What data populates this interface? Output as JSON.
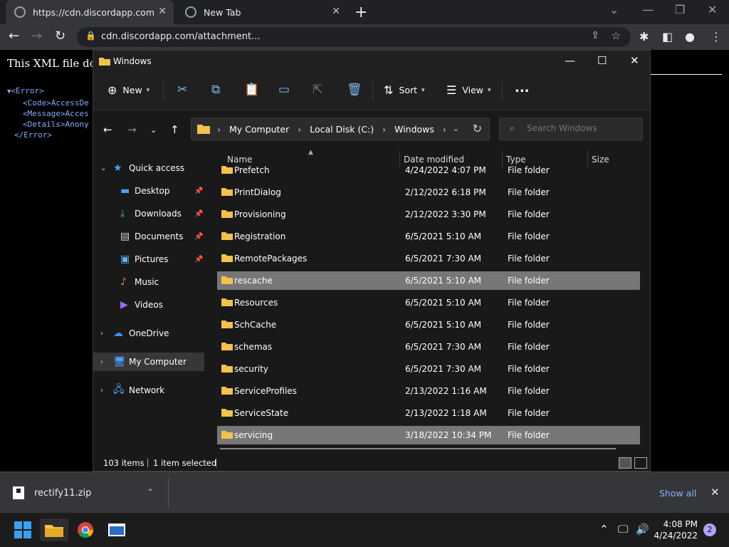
{
  "browser": {
    "tabs": [
      {
        "title": "https://cdn.discordapp.com/attac"
      },
      {
        "title": "New Tab"
      }
    ],
    "address_url": "cdn.discordapp.com/attachment..."
  },
  "page": {
    "heading": "This XML file doe",
    "code_lines": [
      "<Error>",
      "<Code>AccessDe",
      "<Message>Acces",
      "<Details>Anony",
      "</Error>"
    ]
  },
  "explorer": {
    "title": "Windows",
    "commands": {
      "new": "New",
      "sort": "Sort",
      "view": "View",
      "more": "..."
    },
    "breadcrumb": [
      "My Computer",
      "Local Disk (C:)",
      "Windows"
    ],
    "search_placeholder": "Search Windows",
    "nav": {
      "quick_access": "Quick access",
      "desktop": "Desktop",
      "downloads": "Downloads",
      "documents": "Documents",
      "pictures": "Pictures",
      "music": "Music",
      "videos": "Videos",
      "onedrive": "OneDrive",
      "my_computer": "My Computer",
      "network": "Network"
    },
    "columns": {
      "name": "Name",
      "date": "Date modified",
      "type": "Type",
      "size": "Size"
    },
    "files": [
      {
        "name": "Prefetch",
        "date": "4/24/2022 4:07 PM",
        "type": "File folder"
      },
      {
        "name": "PrintDialog",
        "date": "2/12/2022 6:18 PM",
        "type": "File folder"
      },
      {
        "name": "Provisioning",
        "date": "2/12/2022 3:30 PM",
        "type": "File folder"
      },
      {
        "name": "Registration",
        "date": "6/5/2021 5:10 AM",
        "type": "File folder"
      },
      {
        "name": "RemotePackages",
        "date": "6/5/2021 7:30 AM",
        "type": "File folder"
      },
      {
        "name": "rescache",
        "date": "6/5/2021 5:10 AM",
        "type": "File folder"
      },
      {
        "name": "Resources",
        "date": "6/5/2021 5:10 AM",
        "type": "File folder"
      },
      {
        "name": "SchCache",
        "date": "6/5/2021 5:10 AM",
        "type": "File folder"
      },
      {
        "name": "schemas",
        "date": "6/5/2021 7:30 AM",
        "type": "File folder"
      },
      {
        "name": "security",
        "date": "6/5/2021 7:30 AM",
        "type": "File folder"
      },
      {
        "name": "ServiceProfiles",
        "date": "2/13/2022 1:16 AM",
        "type": "File folder"
      },
      {
        "name": "ServiceState",
        "date": "2/13/2022 1:18 AM",
        "type": "File folder"
      },
      {
        "name": "servicing",
        "date": "3/18/2022 10:34 PM",
        "type": "File folder"
      }
    ],
    "status": {
      "count": "103 items",
      "selected": "1 item selected"
    }
  },
  "download_bar": {
    "file": "rectify11.zip",
    "show_all": "Show all"
  },
  "taskbar": {
    "time": "4:08 PM",
    "date": "4/24/2022",
    "notifications": "2"
  },
  "colors": {
    "folder": "#f2c14e",
    "selection": "#777777",
    "accent_link": "#8ab4f8"
  }
}
